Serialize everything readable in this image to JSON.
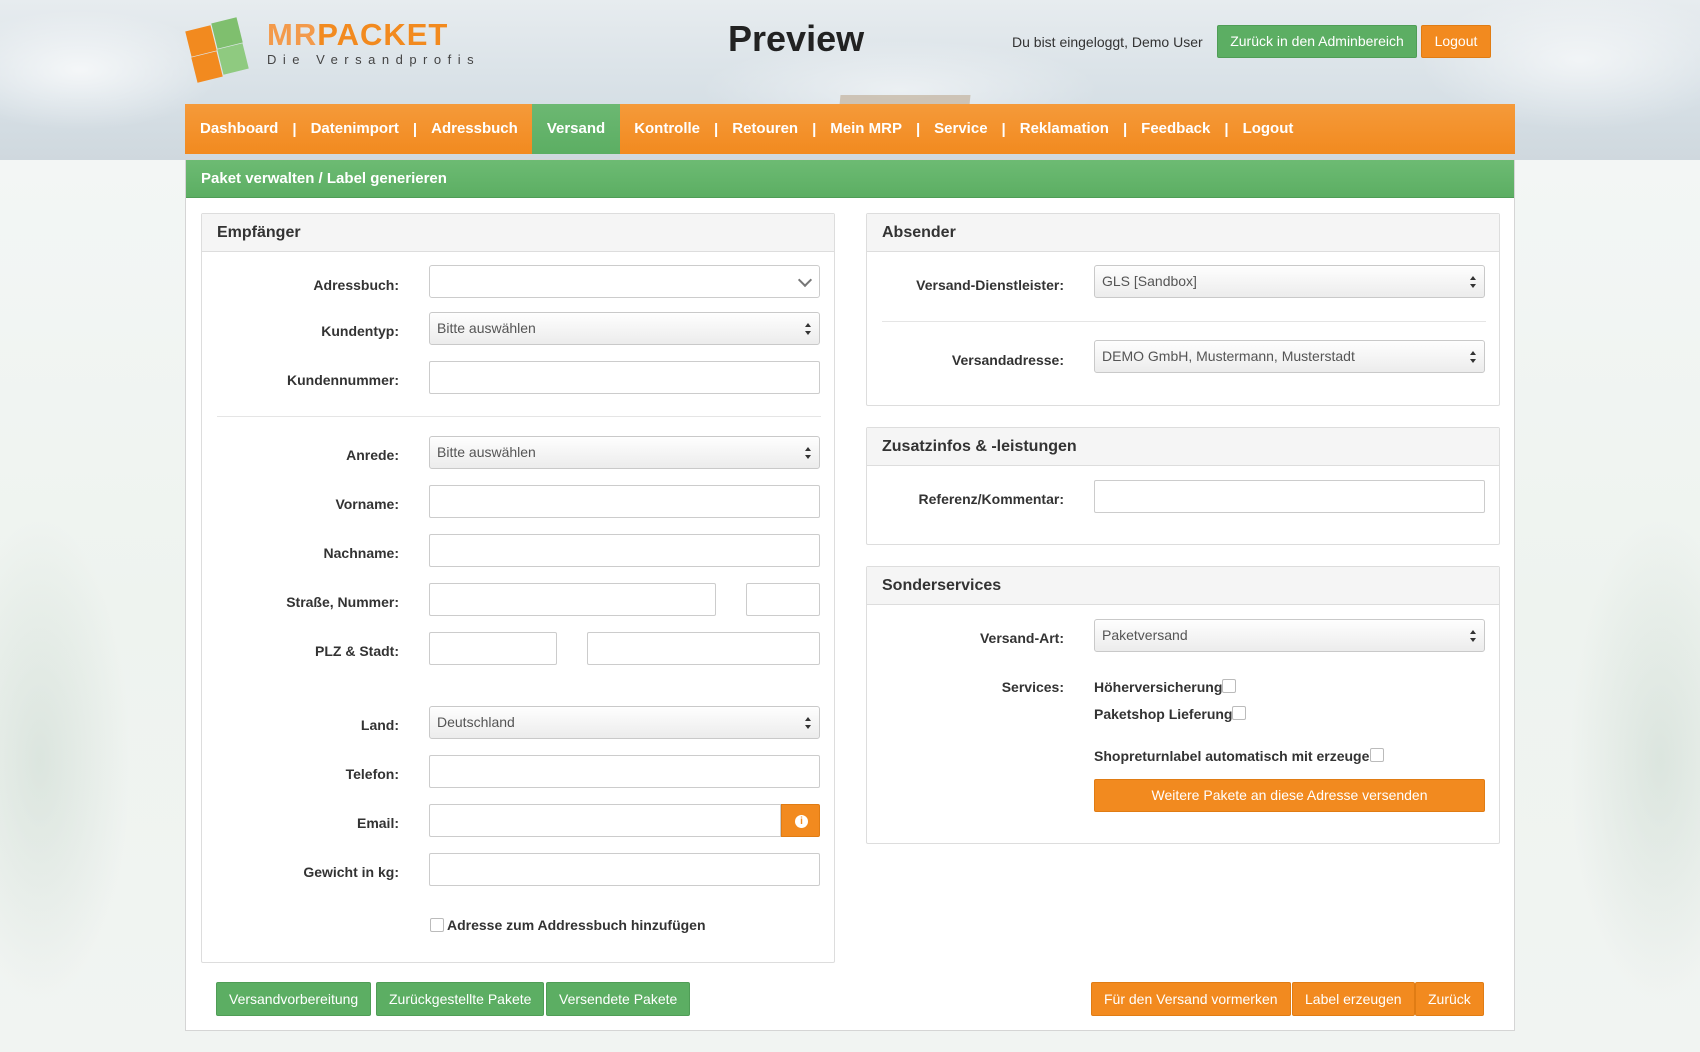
{
  "header": {
    "logo_brand_mr": "MR",
    "logo_brand_packet": "PACKET",
    "logo_sub": "Die Versandprofis",
    "title": "Preview",
    "user_info": "Du bist eingeloggt, Demo User",
    "admin_button": "Zurück in den Adminbereich",
    "logout_button": "Logout"
  },
  "nav": {
    "items": [
      "Dashboard",
      "Datenimport",
      "Adressbuch",
      "Versand",
      "Kontrolle",
      "Retouren",
      "Mein MRP",
      "Service",
      "Reklamation",
      "Feedback",
      "Logout"
    ],
    "separator": "|",
    "active": "Versand"
  },
  "main": {
    "title": "Paket verwalten / Label generieren"
  },
  "empfaenger": {
    "title": "Empfänger",
    "adressbuch_label": "Adressbuch:",
    "adressbuch_value": "",
    "kundentyp_label": "Kundentyp:",
    "kundentyp_value": "Bitte auswählen",
    "kundennummer_label": "Kundennummer:",
    "anrede_label": "Anrede:",
    "anrede_value": "Bitte auswählen",
    "vorname_label": "Vorname:",
    "nachname_label": "Nachname:",
    "strasse_label": "Straße, Nummer:",
    "plz_label": "PLZ & Stadt:",
    "land_label": "Land:",
    "land_value": "Deutschland",
    "telefon_label": "Telefon:",
    "email_label": "Email:",
    "gewicht_label": "Gewicht in kg:",
    "add_address_label": "Adresse zum Addressbuch hinzufügen"
  },
  "absender": {
    "title": "Absender",
    "dienstleister_label": "Versand-Dienstleister:",
    "dienstleister_value": "GLS [Sandbox]",
    "versandadresse_label": "Versandadresse:",
    "versandadresse_value": "DEMO GmbH, Mustermann, Musterstadt"
  },
  "zusatz": {
    "title": "Zusatzinfos & -leistungen",
    "referenz_label": "Referenz/Kommentar:"
  },
  "sonder": {
    "title": "Sonderservices",
    "versandart_label": "Versand-Art:",
    "versandart_value": "Paketversand",
    "services_label": "Services:",
    "hoeherversicherung": "Höherversicherung:",
    "paketshop": "Paketshop Lieferung:",
    "shopreturn": "Shopreturnlabel automatisch mit erzeugen:",
    "weitere_button": "Weitere Pakete an diese Adresse versenden"
  },
  "footer_buttons": {
    "versandvorbereitung": "Versandvorbereitung",
    "zurueckgestellt": "Zurückgestellte Pakete",
    "versendet": "Versendete Pakete",
    "vormerken": "Für den Versand vormerken",
    "label_erzeugen": "Label erzeugen",
    "zurueck": "Zurück"
  },
  "colors": {
    "orange": "#f28a1f",
    "green": "#5cae63"
  },
  "icons": {
    "email_info": "info-circle-icon"
  }
}
